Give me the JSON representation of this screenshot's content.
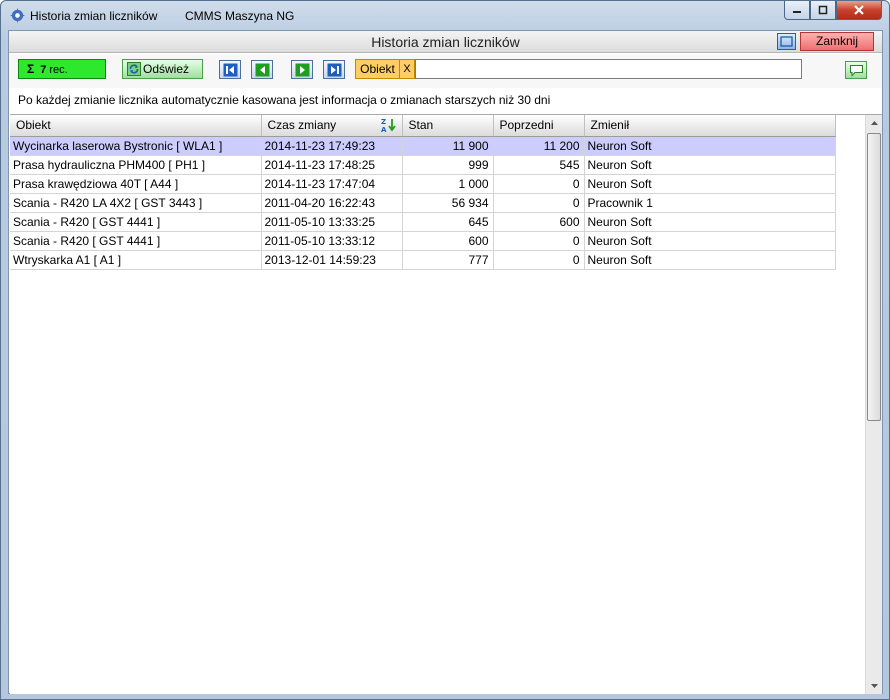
{
  "window": {
    "title": "Historia zmian liczników",
    "app_name": "CMMS Maszyna NG"
  },
  "form": {
    "title": "Historia zmian liczników",
    "close_label": "Zamknij"
  },
  "toolbar": {
    "count_symbol": "Σ",
    "count_value": "7",
    "count_unit": "rec.",
    "refresh_label": "Odśwież",
    "filter_label": "Obiekt",
    "filter_clear": "X",
    "filter_value": ""
  },
  "info_text": "Po każdej zmianie licznika automatycznie kasowana jest informacja o zmianach starszych niż 30 dni",
  "table": {
    "columns": [
      "Obiekt",
      "Czas zmiany",
      "Stan",
      "Poprzedni",
      "Zmienił"
    ],
    "rows": [
      [
        "Wycinarka laserowa Bystronic [ WLA1 ]",
        "2014-11-23  17:49:23",
        "11 900",
        "11 200",
        "Neuron Soft"
      ],
      [
        "Prasa hydrauliczna PHM400 [ PH1 ]",
        "2014-11-23  17:48:25",
        "999",
        "545",
        "Neuron Soft"
      ],
      [
        "Prasa krawędziowa 40T [ A44 ]",
        "2014-11-23  17:47:04",
        "1 000",
        "0",
        "Neuron Soft"
      ],
      [
        "Scania - R420 LA 4X2 [ GST 3443 ]",
        "2011-04-20  16:22:43",
        "56 934",
        "0",
        "Pracownik 1"
      ],
      [
        "Scania - R420 [ GST 4441 ]",
        "2011-05-10  13:33:25",
        "645",
        "600",
        "Neuron Soft"
      ],
      [
        "Scania - R420 [ GST 4441 ]",
        "2011-05-10  13:33:12",
        "600",
        "0",
        "Neuron Soft"
      ],
      [
        "Wtryskarka A1 [ A1 ]",
        "2013-12-01  14:59:23",
        "777",
        "0",
        "Neuron Soft"
      ]
    ],
    "selected_row": 0
  },
  "colors": {
    "count_bg": "#2ee82e",
    "selection": "#ccccff",
    "filter_bg": "#ffcc66",
    "close_bg": "#ee6f6f"
  }
}
